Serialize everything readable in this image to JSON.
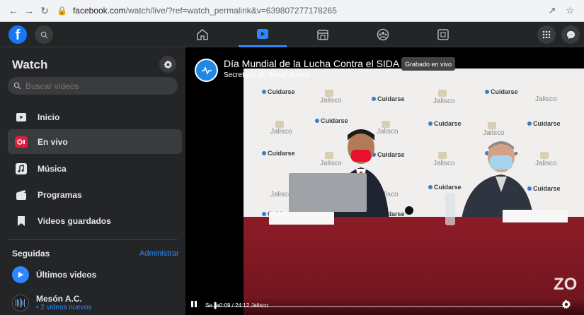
{
  "browser": {
    "url_host": "facebook.com",
    "url_path": "/watch/live/?ref=watch_permalink&v=639807277178265"
  },
  "sidebar": {
    "title": "Watch",
    "search_placeholder": "Buscar videos",
    "items": [
      {
        "label": "Inicio",
        "icon": "tv-icon"
      },
      {
        "label": "En vivo",
        "icon": "live-icon"
      },
      {
        "label": "Música",
        "icon": "music-icon"
      },
      {
        "label": "Programas",
        "icon": "clapper-icon"
      },
      {
        "label": "Videos guardados",
        "icon": "bookmark-icon"
      }
    ],
    "section": "Seguidas",
    "manage": "Administrar",
    "subs": [
      {
        "name": "Últimos videos",
        "meta": ""
      },
      {
        "name": "Mesón A.C.",
        "meta": "• 2 videos nuevos"
      }
    ]
  },
  "video": {
    "title": "Día Mundial de la Lucha Contra el SIDA",
    "badge": "Grabado en vivo",
    "page": "Secretaría de Salud Jalisco",
    "time": "Se▐a0:09 / 24:12 Jalisco",
    "watermark": "ZO"
  },
  "colors": {
    "accent": "#2d88ff",
    "fb_blue": "#1877f2",
    "live_red": "#e41e3f"
  }
}
